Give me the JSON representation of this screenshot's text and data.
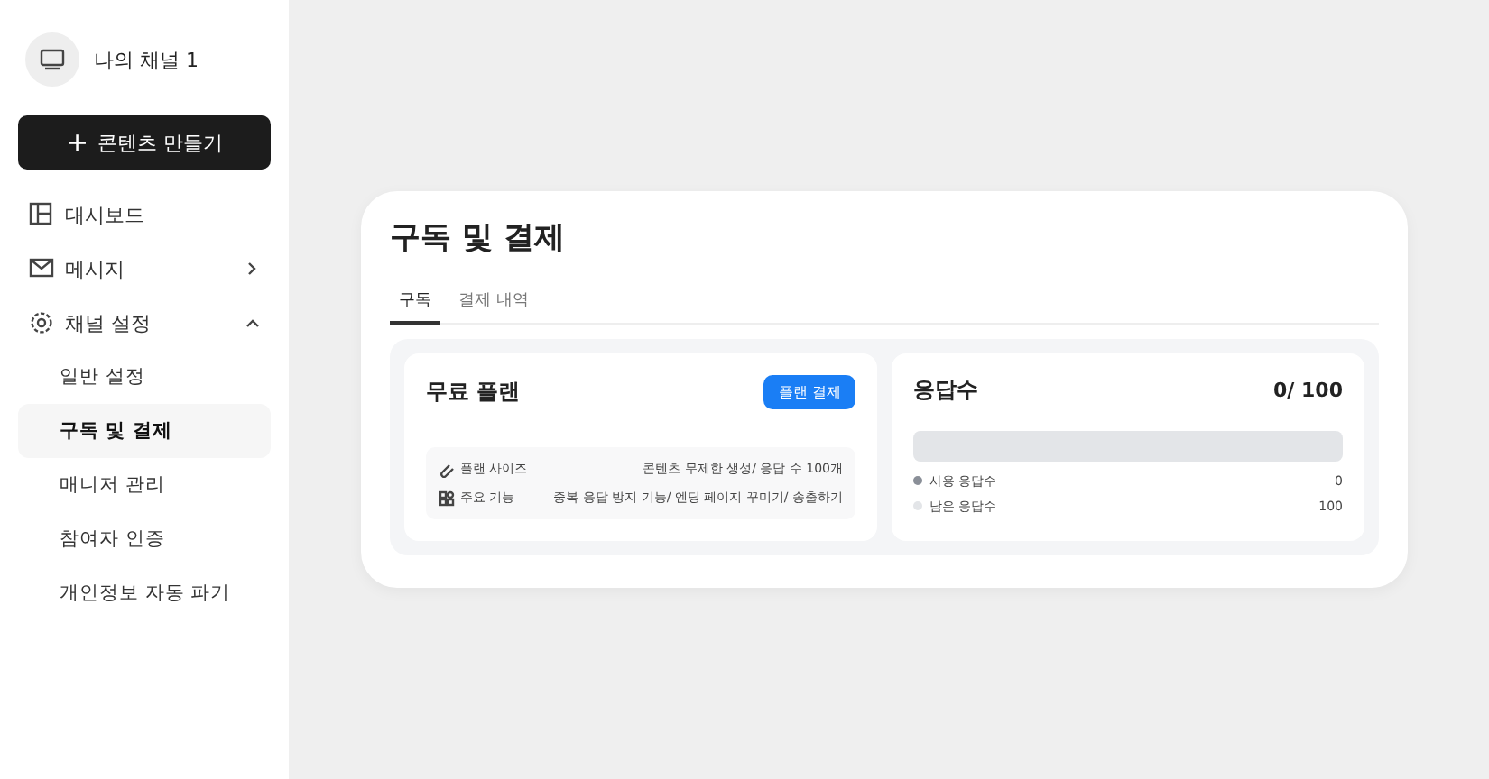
{
  "sidebar": {
    "channel": {
      "name": "나의 채널 1"
    },
    "create_button": {
      "icon": "+",
      "label": "콘텐츠 만들기"
    },
    "items": [
      {
        "label": "대시보드",
        "kind": "dashboard"
      },
      {
        "label": "메시지",
        "kind": "message",
        "expanded": false
      },
      {
        "label": "채널 설정",
        "kind": "settings",
        "expanded": true,
        "children": [
          {
            "label": "일반 설정",
            "selected": false
          },
          {
            "label": "구독 및 결제",
            "selected": true
          },
          {
            "label": "매니저 관리",
            "selected": false
          },
          {
            "label": "참여자 인증",
            "selected": false
          },
          {
            "label": "개인정보 자동 파기",
            "selected": false
          }
        ]
      }
    ]
  },
  "panel": {
    "title": "구독 및 결제",
    "tabs": [
      {
        "label": "구독",
        "selected": true
      },
      {
        "label": "결제 내역",
        "selected": false
      }
    ],
    "plan": {
      "name": "무료 플랜",
      "button": "플랜 결제",
      "features": [
        {
          "kind": "size",
          "label": "플랜 사이즈",
          "value": "콘텐츠 무제한 생성/ 응답 수 100개"
        },
        {
          "kind": "features",
          "label": "주요 기능",
          "value": "중복 응답 방지 기능/ 엔딩 페이지 꾸미기/ 송출하기"
        }
      ]
    },
    "responses": {
      "title": "응답수",
      "count": "0/ 100",
      "legend": [
        {
          "label": "사용 응답수",
          "value": "0",
          "color": "#8a8f98"
        },
        {
          "label": "남은 응답수",
          "value": "100",
          "color": "#e3e5e8"
        }
      ]
    }
  }
}
